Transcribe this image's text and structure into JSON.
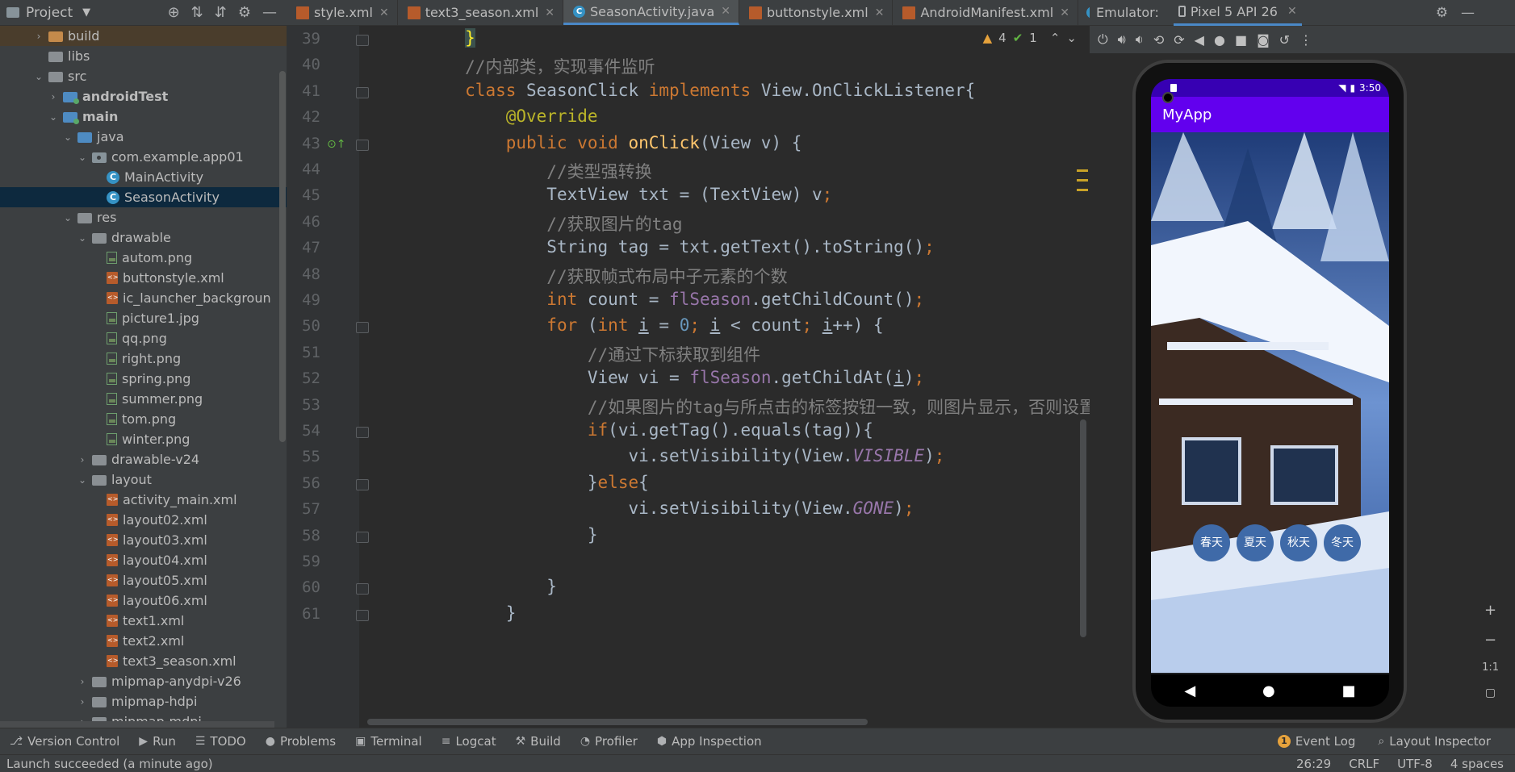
{
  "project": {
    "title": "Project",
    "tree": [
      {
        "label": "build",
        "depth": 2,
        "twisty": "›",
        "icon": "folder-orange",
        "bold": false,
        "highlight": "build"
      },
      {
        "label": "libs",
        "depth": 2,
        "twisty": "",
        "icon": "folder-gray",
        "bold": false
      },
      {
        "label": "src",
        "depth": 2,
        "twisty": "⌄",
        "icon": "folder-gray",
        "bold": false
      },
      {
        "label": "androidTest",
        "depth": 3,
        "twisty": "›",
        "icon": "folder-dot",
        "bold": true
      },
      {
        "label": "main",
        "depth": 3,
        "twisty": "⌄",
        "icon": "folder-dot",
        "bold": true
      },
      {
        "label": "java",
        "depth": 4,
        "twisty": "⌄",
        "icon": "folder-blue",
        "bold": false
      },
      {
        "label": "com.example.app01",
        "depth": 5,
        "twisty": "⌄",
        "icon": "package",
        "bold": false
      },
      {
        "label": "MainActivity",
        "depth": 6,
        "twisty": "",
        "icon": "class",
        "bold": false
      },
      {
        "label": "SeasonActivity",
        "depth": 6,
        "twisty": "",
        "icon": "class",
        "bold": false,
        "selected": true
      },
      {
        "label": "res",
        "depth": 4,
        "twisty": "⌄",
        "icon": "folder-gray",
        "bold": false
      },
      {
        "label": "drawable",
        "depth": 5,
        "twisty": "⌄",
        "icon": "folder-gray",
        "bold": false
      },
      {
        "label": "autom.png",
        "depth": 6,
        "twisty": "",
        "icon": "image",
        "bold": false
      },
      {
        "label": "buttonstyle.xml",
        "depth": 6,
        "twisty": "",
        "icon": "xml",
        "bold": false
      },
      {
        "label": "ic_launcher_backgroun",
        "depth": 6,
        "twisty": "",
        "icon": "xml",
        "bold": false
      },
      {
        "label": "picture1.jpg",
        "depth": 6,
        "twisty": "",
        "icon": "image",
        "bold": false
      },
      {
        "label": "qq.png",
        "depth": 6,
        "twisty": "",
        "icon": "image",
        "bold": false
      },
      {
        "label": "right.png",
        "depth": 6,
        "twisty": "",
        "icon": "image",
        "bold": false
      },
      {
        "label": "spring.png",
        "depth": 6,
        "twisty": "",
        "icon": "image",
        "bold": false
      },
      {
        "label": "summer.png",
        "depth": 6,
        "twisty": "",
        "icon": "image",
        "bold": false
      },
      {
        "label": "tom.png",
        "depth": 6,
        "twisty": "",
        "icon": "image",
        "bold": false
      },
      {
        "label": "winter.png",
        "depth": 6,
        "twisty": "",
        "icon": "image",
        "bold": false
      },
      {
        "label": "drawable-v24",
        "depth": 5,
        "twisty": "›",
        "icon": "folder-gray",
        "bold": false
      },
      {
        "label": "layout",
        "depth": 5,
        "twisty": "⌄",
        "icon": "folder-gray",
        "bold": false
      },
      {
        "label": "activity_main.xml",
        "depth": 6,
        "twisty": "",
        "icon": "xml",
        "bold": false
      },
      {
        "label": "layout02.xml",
        "depth": 6,
        "twisty": "",
        "icon": "xml",
        "bold": false
      },
      {
        "label": "layout03.xml",
        "depth": 6,
        "twisty": "",
        "icon": "xml",
        "bold": false
      },
      {
        "label": "layout04.xml",
        "depth": 6,
        "twisty": "",
        "icon": "xml",
        "bold": false
      },
      {
        "label": "layout05.xml",
        "depth": 6,
        "twisty": "",
        "icon": "xml",
        "bold": false
      },
      {
        "label": "layout06.xml",
        "depth": 6,
        "twisty": "",
        "icon": "xml",
        "bold": false
      },
      {
        "label": "text1.xml",
        "depth": 6,
        "twisty": "",
        "icon": "xml",
        "bold": false
      },
      {
        "label": "text2.xml",
        "depth": 6,
        "twisty": "",
        "icon": "xml",
        "bold": false
      },
      {
        "label": "text3_season.xml",
        "depth": 6,
        "twisty": "",
        "icon": "xml",
        "bold": false
      },
      {
        "label": "mipmap-anydpi-v26",
        "depth": 5,
        "twisty": "›",
        "icon": "folder-gray",
        "bold": false
      },
      {
        "label": "mipmap-hdpi",
        "depth": 5,
        "twisty": "›",
        "icon": "folder-gray",
        "bold": false
      },
      {
        "label": "mipmap-mdpi",
        "depth": 5,
        "twisty": "›",
        "icon": "folder-gray",
        "bold": false
      }
    ]
  },
  "editor": {
    "tabs": [
      {
        "label": "style.xml",
        "icon": "xml",
        "active": false
      },
      {
        "label": "text3_season.xml",
        "icon": "xml",
        "active": false
      },
      {
        "label": "SeasonActivity.java",
        "icon": "class",
        "active": true
      },
      {
        "label": "buttonstyle.xml",
        "icon": "xml",
        "active": false
      },
      {
        "label": "AndroidManifest.xml",
        "icon": "xml",
        "active": false
      }
    ],
    "inspections": {
      "warnings": "4",
      "ok": "1"
    },
    "line_numbers": [
      "39",
      "40",
      "41",
      "42",
      "43",
      "44",
      "45",
      "46",
      "47",
      "48",
      "49",
      "50",
      "51",
      "52",
      "53",
      "54",
      "55",
      "56",
      "57",
      "58",
      "59",
      "60",
      "61"
    ],
    "code_lines": [
      [
        {
          "t": "        "
        },
        {
          "t": "}",
          "c": "brace-hl"
        }
      ],
      [
        {
          "t": "        "
        },
        {
          "t": "//内部类，实现事件监听",
          "c": "cm"
        }
      ],
      [
        {
          "t": "        "
        },
        {
          "t": "class ",
          "c": "kw"
        },
        {
          "t": "SeasonClick "
        },
        {
          "t": "implements ",
          "c": "kw"
        },
        {
          "t": "View.OnClickListener{"
        }
      ],
      [
        {
          "t": "            "
        },
        {
          "t": "@Override",
          "c": "ann"
        }
      ],
      [
        {
          "t": "            "
        },
        {
          "t": "public void ",
          "c": "kw"
        },
        {
          "t": "onClick",
          "c": "fn"
        },
        {
          "t": "(View v) {"
        }
      ],
      [
        {
          "t": "                "
        },
        {
          "t": "//类型强转换",
          "c": "cm"
        }
      ],
      [
        {
          "t": "                "
        },
        {
          "t": "TextView txt = (TextView) v"
        },
        {
          "t": ";",
          "c": "sc"
        }
      ],
      [
        {
          "t": "                "
        },
        {
          "t": "//获取图片的tag",
          "c": "cm"
        }
      ],
      [
        {
          "t": "                "
        },
        {
          "t": "String tag = txt.getText().toString()"
        },
        {
          "t": ";",
          "c": "sc"
        }
      ],
      [
        {
          "t": "                "
        },
        {
          "t": "//获取帧式布局中子元素的个数",
          "c": "cm"
        }
      ],
      [
        {
          "t": "                "
        },
        {
          "t": "int ",
          "c": "kw"
        },
        {
          "t": "count = "
        },
        {
          "t": "flSeason",
          "c": "fld"
        },
        {
          "t": ".getChildCount()"
        },
        {
          "t": ";",
          "c": "sc"
        }
      ],
      [
        {
          "t": "                "
        },
        {
          "t": "for ",
          "c": "kw"
        },
        {
          "t": "("
        },
        {
          "t": "int ",
          "c": "kw"
        },
        {
          "t": "i",
          "c": "ul"
        },
        {
          "t": " = "
        },
        {
          "t": "0",
          "c": "num"
        },
        {
          "t": "; ",
          "c": "sc"
        },
        {
          "t": "i",
          "c": "ul"
        },
        {
          "t": " < count"
        },
        {
          "t": "; ",
          "c": "sc"
        },
        {
          "t": "i",
          "c": "ul"
        },
        {
          "t": "++) {"
        }
      ],
      [
        {
          "t": "                    "
        },
        {
          "t": "//通过下标获取到组件",
          "c": "cm"
        }
      ],
      [
        {
          "t": "                    "
        },
        {
          "t": "View vi = "
        },
        {
          "t": "flSeason",
          "c": "fld"
        },
        {
          "t": ".getChildAt("
        },
        {
          "t": "i",
          "c": "ul"
        },
        {
          "t": ")"
        },
        {
          "t": ";",
          "c": "sc"
        }
      ],
      [
        {
          "t": "                    "
        },
        {
          "t": "//如果图片的tag与所点击的标签按钮一致，则图片显示，否则设置",
          "c": "cm"
        }
      ],
      [
        {
          "t": "                    "
        },
        {
          "t": "if",
          "c": "kw"
        },
        {
          "t": "(vi.getTag().equals(tag)){"
        }
      ],
      [
        {
          "t": "                        "
        },
        {
          "t": "vi.setVisibility(View."
        },
        {
          "t": "VISIBLE",
          "c": "it"
        },
        {
          "t": ")"
        },
        {
          "t": ";",
          "c": "sc"
        }
      ],
      [
        {
          "t": "                    "
        },
        {
          "t": "}"
        },
        {
          "t": "else",
          "c": "kw"
        },
        {
          "t": "{"
        }
      ],
      [
        {
          "t": "                        "
        },
        {
          "t": "vi.setVisibility(View."
        },
        {
          "t": "GONE",
          "c": "it"
        },
        {
          "t": ")"
        },
        {
          "t": ";",
          "c": "sc"
        }
      ],
      [
        {
          "t": "                    "
        },
        {
          "t": "}"
        }
      ],
      [
        {
          "t": ""
        }
      ],
      [
        {
          "t": "                "
        },
        {
          "t": "}"
        }
      ],
      [
        {
          "t": "            "
        },
        {
          "t": "}"
        }
      ]
    ]
  },
  "emulator": {
    "label": "Emulator:",
    "device": "Pixel 5 API 26",
    "phone": {
      "time": "3:50",
      "app_title": "MyApp",
      "season_buttons": [
        "春天",
        "夏天",
        "秋天",
        "冬天"
      ],
      "nav": {
        "back": "◀",
        "home": "●",
        "recents": "■"
      }
    },
    "zoom": {
      "plus": "+",
      "minus": "−",
      "one_to_one": "1:1"
    }
  },
  "tool_windows": {
    "left": [
      {
        "label": "Version Control",
        "icon": "⎇"
      },
      {
        "label": "Run",
        "icon": "▶"
      },
      {
        "label": "TODO",
        "icon": "☰"
      },
      {
        "label": "Problems",
        "icon": "●"
      },
      {
        "label": "Terminal",
        "icon": "▣"
      },
      {
        "label": "Logcat",
        "icon": "≡"
      },
      {
        "label": "Build",
        "icon": "⚒"
      },
      {
        "label": "Profiler",
        "icon": "◔"
      },
      {
        "label": "App Inspection",
        "icon": "⬢"
      }
    ],
    "right": [
      {
        "label": "Event Log",
        "badge": "1"
      },
      {
        "label": "Layout Inspector",
        "icon": "⌕"
      }
    ]
  },
  "status": {
    "message": "Launch succeeded (a minute ago)",
    "position": "26:29",
    "line_sep": "CRLF",
    "encoding": "UTF-8",
    "indent": "4 spaces"
  },
  "colors": {
    "accent": "#4a88c7",
    "app_bar": "#6200ee",
    "status_bar": "#3700b3",
    "keyword": "#cc7832",
    "comment": "#808080"
  }
}
